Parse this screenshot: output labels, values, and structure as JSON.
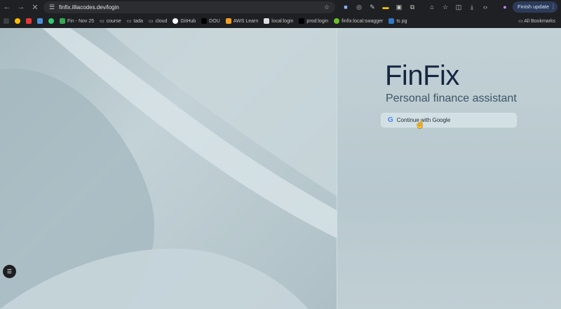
{
  "browser": {
    "url": "finfix.illiacodes.dev/login",
    "finish_update": "Finish update"
  },
  "bookmarks": [
    {
      "label": "Fin - Nov 25",
      "color": "#34a853"
    },
    {
      "label": "course"
    },
    {
      "label": "tada"
    },
    {
      "label": "cloud"
    },
    {
      "label": "GitHub"
    },
    {
      "label": "DOU"
    },
    {
      "label": "AWS Learn"
    },
    {
      "label": "local:login"
    },
    {
      "label": "prod:login"
    },
    {
      "label": "finfix:local:swagger"
    },
    {
      "label": "ts pg"
    }
  ],
  "all_bookmarks": "All Bookmarks",
  "app": {
    "title": "FinFix",
    "subtitle": "Personal finance assistant",
    "google_button": "Continue with Google"
  }
}
